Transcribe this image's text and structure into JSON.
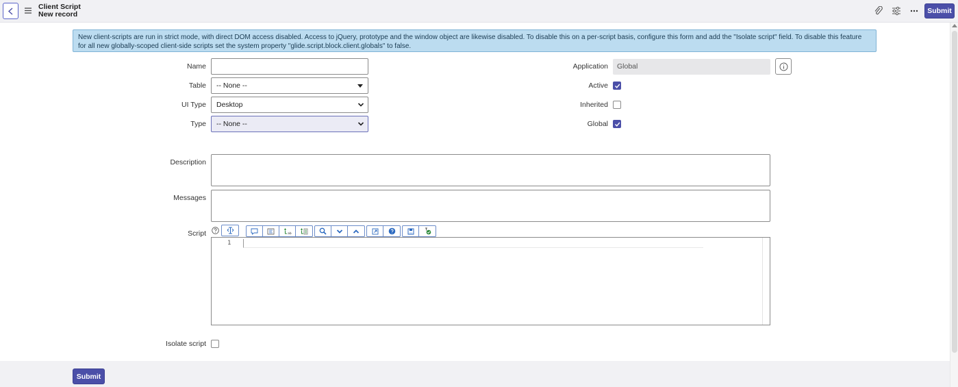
{
  "header": {
    "title": "Client Script",
    "subtitle": "New record",
    "submit_label": "Submit"
  },
  "banner": {
    "text": "New client-scripts are run in strict mode, with direct DOM access disabled. Access to jQuery, prototype and the window object are likewise disabled. To disable this on a per-script basis, configure this form and add the \"Isolate script\" field. To disable this feature for all new globally-scoped client-side scripts set the system property \"glide.script.block.client.globals\" to false."
  },
  "form": {
    "name_label": "Name",
    "name_value": "",
    "table_label": "Table",
    "table_value": "-- None --",
    "ui_type_label": "UI Type",
    "ui_type_value": "Desktop",
    "type_label": "Type",
    "type_value": "-- None --",
    "application_label": "Application",
    "application_value": "Global",
    "active_label": "Active",
    "active_checked": true,
    "inherited_label": "Inherited",
    "inherited_checked": false,
    "global_label": "Global",
    "global_checked": true,
    "description_label": "Description",
    "messages_label": "Messages",
    "script_label": "Script",
    "line_number": "1",
    "isolate_label": "Isolate script",
    "isolate_checked": false
  },
  "footer": {
    "submit_label": "Submit"
  },
  "colors": {
    "accent": "#4b4fa8",
    "banner_bg": "#bcdcf0",
    "header_bg": "#f1f1f4"
  }
}
